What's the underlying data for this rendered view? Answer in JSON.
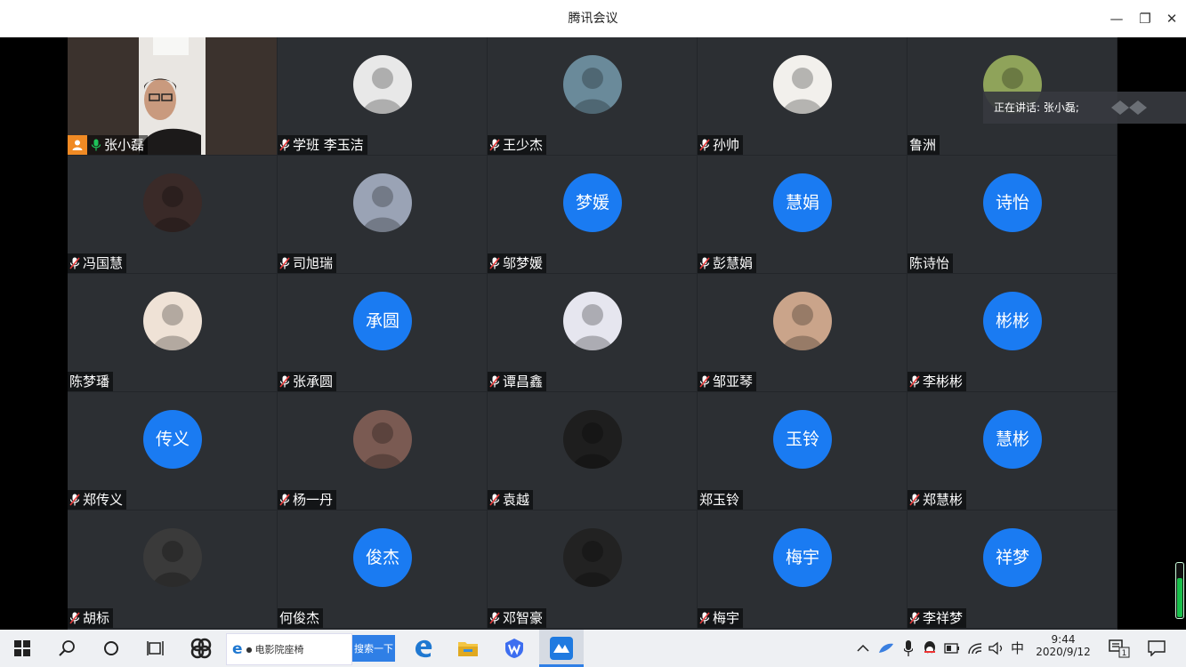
{
  "window": {
    "title": "腾讯会议",
    "minimize": "—",
    "maximize": "❐",
    "close": "✕"
  },
  "speaking": {
    "label": "正在讲话: 张小磊;"
  },
  "participants": [
    {
      "name": "张小磊",
      "avatar": "video",
      "mic": "on",
      "host": true
    },
    {
      "name": "学班 李玉洁",
      "avatar": "image",
      "mic": "muted"
    },
    {
      "name": "王少杰",
      "avatar": "image",
      "mic": "muted"
    },
    {
      "name": "孙帅",
      "avatar": "image",
      "mic": "muted"
    },
    {
      "name": "鲁洲",
      "avatar": "image",
      "mic": "none"
    },
    {
      "name": "冯国慧",
      "avatar": "image",
      "mic": "muted"
    },
    {
      "name": "司旭瑞",
      "avatar": "image",
      "mic": "muted"
    },
    {
      "name": "邬梦媛",
      "avatar": "initials",
      "initials": "梦媛",
      "mic": "muted"
    },
    {
      "name": "彭慧娟",
      "avatar": "initials",
      "initials": "慧娟",
      "mic": "muted"
    },
    {
      "name": "陈诗怡",
      "avatar": "initials",
      "initials": "诗怡",
      "mic": "none"
    },
    {
      "name": "陈梦璠",
      "avatar": "image",
      "mic": "none"
    },
    {
      "name": "张承圆",
      "avatar": "initials",
      "initials": "承圆",
      "mic": "muted"
    },
    {
      "name": "谭昌鑫",
      "avatar": "image",
      "mic": "muted"
    },
    {
      "name": "邹亚琴",
      "avatar": "image",
      "mic": "muted"
    },
    {
      "name": "李彬彬",
      "avatar": "initials",
      "initials": "彬彬",
      "mic": "muted"
    },
    {
      "name": "郑传义",
      "avatar": "initials",
      "initials": "传义",
      "mic": "muted"
    },
    {
      "name": "杨一丹",
      "avatar": "image",
      "mic": "muted"
    },
    {
      "name": "袁越",
      "avatar": "image",
      "mic": "muted"
    },
    {
      "name": "郑玉铃",
      "avatar": "initials",
      "initials": "玉铃",
      "mic": "none"
    },
    {
      "name": "郑慧彬",
      "avatar": "initials",
      "initials": "慧彬",
      "mic": "muted"
    },
    {
      "name": "胡标",
      "avatar": "image",
      "mic": "muted"
    },
    {
      "name": "何俊杰",
      "avatar": "initials",
      "initials": "俊杰",
      "mic": "none"
    },
    {
      "name": "邓智豪",
      "avatar": "image",
      "mic": "muted"
    },
    {
      "name": "梅宇",
      "avatar": "initials",
      "initials": "梅宇",
      "mic": "muted"
    },
    {
      "name": "李祥梦",
      "avatar": "initials",
      "initials": "祥梦",
      "mic": "muted"
    }
  ],
  "colors": {
    "initials_bg": "#1a7bf2",
    "tile_bg": "#2c2f33",
    "active_border": "#17b35a",
    "host_badge": "#f08a24"
  },
  "volume": {
    "level": 0.75
  },
  "taskbar": {
    "ie_text": "电影院座椅",
    "search_button": "搜索一下",
    "ime": "中",
    "time": "9:44",
    "date": "2020/9/12",
    "notification_count": "1"
  }
}
